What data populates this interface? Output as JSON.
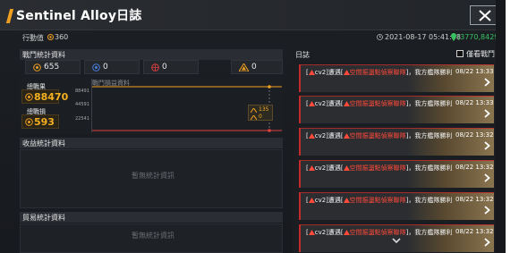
{
  "window": {
    "title": "Sentinel Alloy日誌",
    "close_icon": "close-icon"
  },
  "status": {
    "action_label": "行動值",
    "action_value": "360",
    "timestamp": "2021-08-17 05:41:08",
    "coords": "(3770,8429)",
    "colors": {
      "coords": "#38c060",
      "accent": "#f0a020"
    }
  },
  "battle_stats": {
    "title": "戰鬥統計資料",
    "stats": [
      {
        "icon": "target-icon",
        "value": "655"
      },
      {
        "icon": "shield-icon",
        "value": "0"
      },
      {
        "icon": "crosshair-icon",
        "value": "0"
      },
      {
        "icon": "rank-icon",
        "value": "0"
      }
    ],
    "chart_title": "戰鬥損益資料",
    "total_gain_label": "總戰果",
    "total_gain_value": "88470",
    "total_loss_label": "總戰損",
    "total_loss_value": "593",
    "ytick_top": "88491",
    "ytick_mid": "44591",
    "ytick_low": "22541",
    "tooltip_top": "135",
    "tooltip_bottom": "0"
  },
  "income_stats": {
    "title": "收益統計資料",
    "empty": "暫無統計資訊"
  },
  "trade_stats": {
    "title": "貿易統計資料",
    "empty": "暫無統計資訊"
  },
  "log": {
    "title": "日誌",
    "filter_label": "僅看戰鬥",
    "entries": [
      {
        "prefix": "[",
        "who": "cv2]遭遇[",
        "target": "空間振盪點偵察聯隊",
        "suffix": "]，我方艦隊勝利",
        "date": "08/22 13:33"
      },
      {
        "prefix": "[",
        "who": "cv2]遭遇[",
        "target": "空間振盪點偵察聯隊",
        "suffix": "]，我方艦隊勝利",
        "date": "08/22 13:33"
      },
      {
        "prefix": "[",
        "who": "cv2]遭遇[",
        "target": "空間振盪點偵察聯隊",
        "suffix": "]，我方艦隊勝利",
        "date": "08/22 13:32"
      },
      {
        "prefix": "[",
        "who": "cv2]遭遇[",
        "target": "空間振盪點偵察聯隊",
        "suffix": "]，我方艦隊勝利",
        "date": "08/22 13:32"
      },
      {
        "prefix": "[",
        "who": "cv2]遭遇[",
        "target": "空間振盪點偵察聯隊",
        "suffix": "]，我方艦隊勝利",
        "date": "08/22 13:32"
      },
      {
        "prefix": "[",
        "who": "cv2]遭遇[",
        "target": "空間振盪點偵察聯隊",
        "suffix": "]，我方艦隊勝利",
        "date": "08/22 13:32"
      }
    ]
  }
}
